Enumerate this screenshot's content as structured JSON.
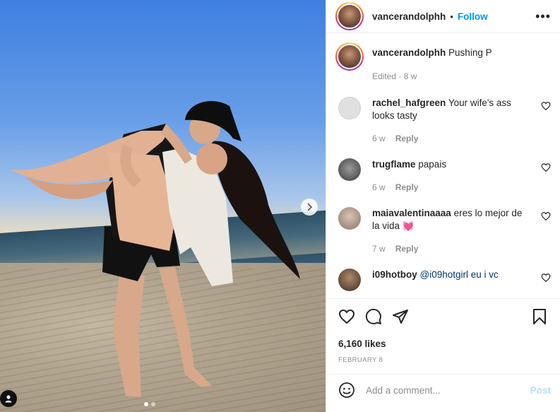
{
  "post": {
    "username": "vancerandolphh",
    "follow_label": "Follow",
    "separator": "•",
    "more_label": "•••"
  },
  "caption": {
    "username": "vancerandolphh",
    "text": "Pushing P",
    "meta": "Edited · 8 w"
  },
  "comments": [
    {
      "username": "rachel_hafgreen",
      "text": "Your wife's ass looks tasty",
      "age": "6 w",
      "reply_label": "Reply"
    },
    {
      "username": "trugflame",
      "text": "papais",
      "age": "6 w",
      "reply_label": "Reply"
    },
    {
      "username": "maiavalentinaaaa",
      "text": "eres lo mejor de la vida 💓",
      "age": "7 w",
      "reply_label": "Reply"
    },
    {
      "username": "i09hotboy",
      "text": "@i09hotgirl eu i vc",
      "age": "",
      "reply_label": ""
    }
  ],
  "likes": "6,160 likes",
  "date": "FEBRUARY 8",
  "add_comment": {
    "placeholder": "Add a comment...",
    "post_label": "Post"
  },
  "colors": {
    "accent": "#0095f6",
    "post_disabled": "#b2dffc",
    "text": "#262626",
    "muted": "#8e8e8e"
  },
  "icons": [
    "heart-icon",
    "comment-icon",
    "share-icon",
    "bookmark-icon",
    "emoji-icon",
    "chevron-right-icon",
    "more-icon",
    "user-tag-icon"
  ],
  "carousel": {
    "total": 2,
    "active": 1
  }
}
